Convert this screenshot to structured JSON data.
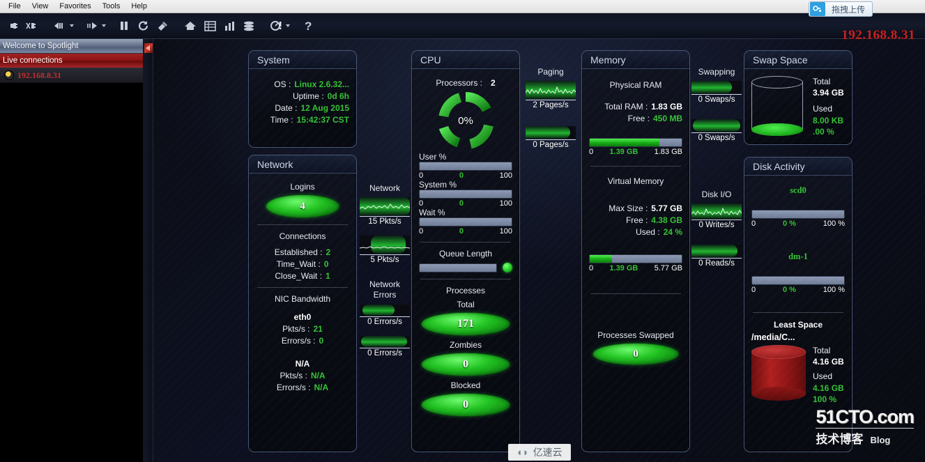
{
  "menu": {
    "items": [
      "File",
      "View",
      "Favorites",
      "Tools",
      "Help"
    ]
  },
  "toolbar": {
    "icons": [
      {
        "name": "connect-icon",
        "title": "Connect"
      },
      {
        "name": "disconnect-icon",
        "title": "Disconnect"
      },
      {
        "name": "back-arrow-icon",
        "title": "Back"
      },
      {
        "name": "forward-arrow-icon",
        "title": "Forward"
      },
      {
        "name": "pause-icon",
        "title": "Pause"
      },
      {
        "name": "refresh-icon",
        "title": "Refresh"
      },
      {
        "name": "calibrate-icon",
        "title": "Calibrate"
      },
      {
        "name": "home-icon",
        "title": "Home"
      },
      {
        "name": "grid-icon",
        "title": "Details"
      },
      {
        "name": "bar-chart-icon",
        "title": "Charts"
      },
      {
        "name": "database-icon",
        "title": "Database"
      },
      {
        "name": "alarm-icon",
        "title": "Alarms"
      },
      {
        "name": "help-icon",
        "title": "Help"
      }
    ],
    "upload_label": "拖拽上传",
    "upload_icon": "cloud-upload-icon"
  },
  "header": {
    "connection_ip": "192.168.8.31"
  },
  "sidebar": {
    "welcome": "Welcome to Spotlight",
    "group": "Live connections",
    "connection": "192.168.8.31",
    "connection_icon": "linux-penguin-icon"
  },
  "system": {
    "title": "System",
    "rows": [
      {
        "label": "OS :",
        "value": "Linux 2.6.32..."
      },
      {
        "label": "Uptime :",
        "value": "0d 6h"
      },
      {
        "label": "Date :",
        "value": "12 Aug 2015"
      },
      {
        "label": "Time :",
        "value": "15:42:37 CST"
      }
    ]
  },
  "network_panel": {
    "title": "Network",
    "logins_label": "Logins",
    "logins_value": "4",
    "connections_label": "Connections",
    "connections": [
      {
        "label": "Established :",
        "value": "2"
      },
      {
        "label": "Time_Wait :",
        "value": "0"
      },
      {
        "label": "Close_Wait :",
        "value": "1"
      }
    ],
    "nic_label": "NIC Bandwidth",
    "nics": [
      {
        "name": "eth0",
        "pkts_label": "Pkts/s :",
        "pkts": "21",
        "errors_label": "Errors/s :",
        "errors": "0"
      },
      {
        "name": "N/A",
        "pkts_label": "Pkts/s :",
        "pkts": "N/A",
        "errors_label": "Errors/s :",
        "errors": "N/A"
      }
    ]
  },
  "cpu": {
    "title": "CPU",
    "processors_label": "Processors :",
    "processors": "2",
    "usage_percent": "0%",
    "usage_value": 0,
    "bars": [
      {
        "label": "User %",
        "min": "0",
        "value": "0",
        "max": "100",
        "pct": 0
      },
      {
        "label": "System %",
        "min": "0",
        "value": "0",
        "max": "100",
        "pct": 0
      },
      {
        "label": "Wait %",
        "min": "0",
        "value": "0",
        "max": "100",
        "pct": 0
      }
    ],
    "queue_label": "Queue Length",
    "queue_pct": 0,
    "processes_label": "Processes",
    "processes": [
      {
        "label": "Total",
        "value": "171"
      },
      {
        "label": "Zombies",
        "value": "0"
      },
      {
        "label": "Blocked",
        "value": "0"
      }
    ]
  },
  "paging": {
    "title": "Paging",
    "flows": [
      {
        "value": "2 Pages/s",
        "style": "spark"
      },
      {
        "value": "0 Pages/s",
        "style": "blob"
      }
    ]
  },
  "network_flow": {
    "title": "Network",
    "flows": [
      {
        "value": "15 Pkts/s",
        "style": "spark"
      },
      {
        "value": "5 Pkts/s",
        "style": "spark"
      }
    ],
    "errors_title": "Network Errors",
    "errors": [
      {
        "value": "0 Errors/s",
        "style": "blob"
      },
      {
        "value": "0 Errors/s",
        "style": "blob"
      }
    ]
  },
  "swapping": {
    "title": "Swapping",
    "flows": [
      {
        "value": "0 Swaps/s",
        "style": "blob"
      },
      {
        "value": "0 Swaps/s",
        "style": "blob"
      }
    ]
  },
  "diskio": {
    "title": "Disk I/O",
    "flows": [
      {
        "value": "0 Writes/s",
        "style": "spark"
      },
      {
        "value": "0 Reads/s",
        "style": "blob"
      }
    ]
  },
  "memory": {
    "title": "Memory",
    "physical_label": "Physical RAM",
    "physical_rows": [
      {
        "label": "Total RAM :",
        "value": "1.83 GB",
        "color": "white"
      },
      {
        "label": "Free :",
        "value": "450 MB",
        "color": "green"
      }
    ],
    "physical_bar": {
      "min": "0",
      "value": "1.39 GB",
      "max": "1.83 GB",
      "pct": 76
    },
    "virtual_label": "Virtual Memory",
    "virtual_rows": [
      {
        "label": "Max Size :",
        "value": "5.77 GB",
        "color": "white"
      },
      {
        "label": "Free :",
        "value": "4.38 GB",
        "color": "green"
      },
      {
        "label": "Used :",
        "value": "24 %",
        "color": "green"
      }
    ],
    "virtual_bar": {
      "min": "0",
      "value": "1.39 GB",
      "max": "5.77 GB",
      "pct": 24
    },
    "swapped_label": "Processes Swapped",
    "swapped_value": "0"
  },
  "swap_space": {
    "title": "Swap Space",
    "total_label": "Total",
    "total_value": "3.94 GB",
    "used_label": "Used",
    "used_value": "8.00 KB",
    "used_pct": ".00 %",
    "fill_pct": 4
  },
  "disk_activity": {
    "title": "Disk Activity",
    "disks": [
      {
        "name": "scd0",
        "min": "0",
        "value": "0 %",
        "max": "100 %",
        "pct": 0
      },
      {
        "name": "dm-1",
        "min": "0",
        "value": "0 %",
        "max": "100 %",
        "pct": 0
      }
    ],
    "least_space_label": "Least Space",
    "mount": "/media/C...",
    "total_label": "Total",
    "total_value": "4.16 GB",
    "used_label": "Used",
    "used_value": "4.16 GB",
    "used_pct": "100 %",
    "fill_pct": 100
  },
  "watermark": {
    "site": "51CTO.com",
    "tagline": "技术博客",
    "blog": "Blog",
    "bottom": "亿速云"
  },
  "colors": {
    "green": "#35c235",
    "red": "#cc2222",
    "panel_border": "#4a5878",
    "bar_track": "#7f8ca6"
  }
}
